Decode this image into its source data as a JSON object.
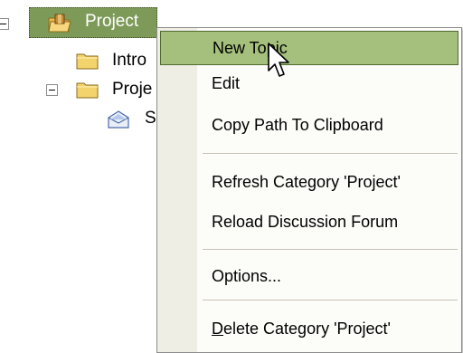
{
  "tree": {
    "root": {
      "label": "Project"
    },
    "children": [
      {
        "label": "Intro"
      },
      {
        "label": "Proje"
      },
      {
        "label": "S"
      }
    ]
  },
  "context_menu": {
    "items": [
      {
        "label": "New Topic",
        "state": "hover"
      },
      {
        "label": "Edit"
      },
      {
        "label": "Copy Path To Clipboard"
      },
      {
        "label": "Refresh Category 'Project'"
      },
      {
        "label": "Reload Discussion Forum"
      },
      {
        "label": "Options..."
      },
      {
        "label": "elete Category 'Project'",
        "prefix": "D"
      }
    ]
  },
  "colors": {
    "selection_green": "#7e9a59",
    "menu_hover_green": "#a5c07c",
    "menu_gutter": "#efeee4",
    "menu_background": "#fcfcf9"
  }
}
